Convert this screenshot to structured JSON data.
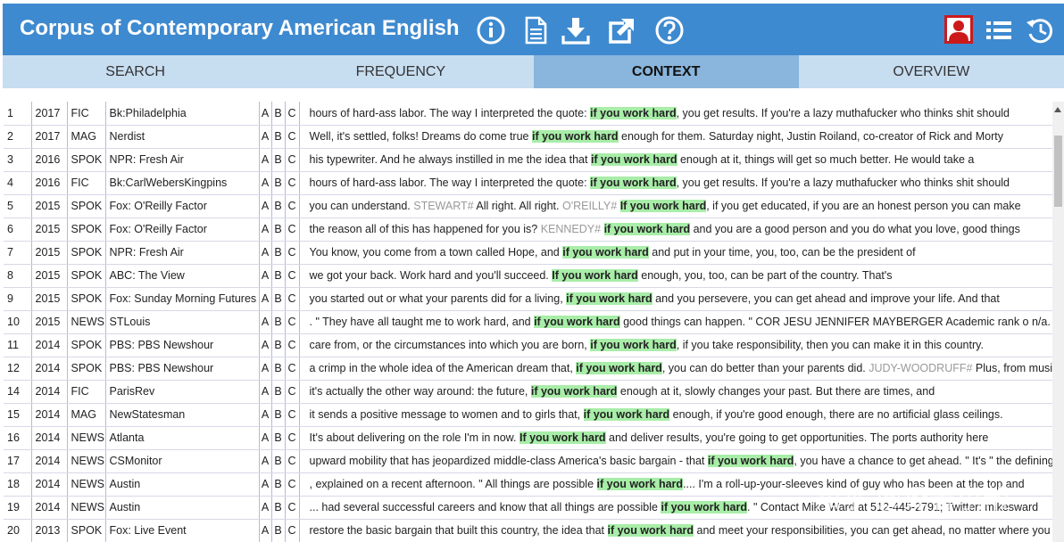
{
  "app": {
    "title": "Corpus of Contemporary American English",
    "icons": [
      "info-icon",
      "document-icon",
      "download-icon",
      "external-link-icon",
      "help-icon",
      "user-icon",
      "list-icon",
      "history-icon"
    ],
    "colors": {
      "header": "#3e8ad0",
      "tabs": "#c7ddf0",
      "active_tab": "#8ab5dc",
      "keyword_highlight": "#a8eda8",
      "user_icon_border": "#cc1a1a"
    }
  },
  "tabs": [
    {
      "label": "SEARCH",
      "active": false
    },
    {
      "label": "FREQUENCY",
      "active": false
    },
    {
      "label": "CONTEXT",
      "active": true
    },
    {
      "label": "OVERVIEW",
      "active": false
    }
  ],
  "results": [
    {
      "n": "1",
      "year": "2017",
      "genre": "FIC",
      "source": "Bk:Philadelphia",
      "a": "A",
      "b": "B",
      "c": "C",
      "segments": [
        {
          "t": "hours of hard-ass labor. The way I interpreted the quote: "
        },
        {
          "t": "if you work hard",
          "kw": true
        },
        {
          "t": ", you get results. If you're a lazy muthafucker who thinks shit should"
        }
      ]
    },
    {
      "n": "2",
      "year": "2017",
      "genre": "MAG",
      "source": "Nerdist",
      "a": "A",
      "b": "B",
      "c": "C",
      "segments": [
        {
          "t": "Well, it's settled, folks! Dreams do come true "
        },
        {
          "t": "if you work hard",
          "kw": true
        },
        {
          "t": " enough for them. Saturday night, Justin Roiland, co-creator of Rick and Morty"
        }
      ]
    },
    {
      "n": "3",
      "year": "2016",
      "genre": "SPOK",
      "source": "NPR: Fresh Air",
      "a": "A",
      "b": "B",
      "c": "C",
      "segments": [
        {
          "t": "his typewriter. And he always instilled in me the idea that "
        },
        {
          "t": "if you work hard",
          "kw": true
        },
        {
          "t": " enough at it, things will get so much better. He would take a"
        }
      ]
    },
    {
      "n": "4",
      "year": "2016",
      "genre": "FIC",
      "source": "Bk:CarlWebersKingpins",
      "a": "A",
      "b": "B",
      "c": "C",
      "segments": [
        {
          "t": "hours of hard-ass labor. The way I interpreted the quote: "
        },
        {
          "t": "if you work hard",
          "kw": true
        },
        {
          "t": ", you get results. If you're a lazy muthafucker who thinks shit should"
        }
      ]
    },
    {
      "n": "5",
      "year": "2015",
      "genre": "SPOK",
      "source": "Fox: O'Reilly Factor",
      "a": "A",
      "b": "B",
      "c": "C",
      "segments": [
        {
          "t": "you can understand. "
        },
        {
          "t": "STEWART#",
          "spk": true
        },
        {
          "t": " All right. All right. "
        },
        {
          "t": "O'REILLY#",
          "spk": true
        },
        {
          "t": " "
        },
        {
          "t": "If you work hard",
          "kw": true
        },
        {
          "t": ", if you get educated, if you are an honest person you can make"
        }
      ]
    },
    {
      "n": "6",
      "year": "2015",
      "genre": "SPOK",
      "source": "Fox: O'Reilly Factor",
      "a": "A",
      "b": "B",
      "c": "C",
      "segments": [
        {
          "t": "the reason all of this has happened for you is? "
        },
        {
          "t": "KENNEDY#",
          "spk": true
        },
        {
          "t": " "
        },
        {
          "t": "if you work hard",
          "kw": true
        },
        {
          "t": " and you are a good person and you do what you love, good things"
        }
      ]
    },
    {
      "n": "7",
      "year": "2015",
      "genre": "SPOK",
      "source": "NPR: Fresh Air",
      "a": "A",
      "b": "B",
      "c": "C",
      "segments": [
        {
          "t": "You know, you come from a town called Hope, and "
        },
        {
          "t": "if you work hard",
          "kw": true
        },
        {
          "t": " and put in your time, you, too, can be the president of"
        }
      ]
    },
    {
      "n": "8",
      "year": "2015",
      "genre": "SPOK",
      "source": "ABC: The View",
      "a": "A",
      "b": "B",
      "c": "C",
      "segments": [
        {
          "t": "we got your back. Work hard and you'll succeed. "
        },
        {
          "t": "If you work hard",
          "kw": true
        },
        {
          "t": " enough, you, too, can be part of the country. That's"
        }
      ]
    },
    {
      "n": "9",
      "year": "2015",
      "genre": "SPOK",
      "source": "Fox: Sunday Morning Futures",
      "a": "A",
      "b": "B",
      "c": "C",
      "segments": [
        {
          "t": "you started out or what your parents did for a living, "
        },
        {
          "t": "if you work hard",
          "kw": true
        },
        {
          "t": " and you persevere, you can get ahead and improve your life. And that"
        }
      ]
    },
    {
      "n": "10",
      "year": "2015",
      "genre": "NEWS",
      "source": "STLouis",
      "a": "A",
      "b": "B",
      "c": "C",
      "segments": [
        {
          "t": ". \" They have all taught me to work hard, and "
        },
        {
          "t": "if you work hard",
          "kw": true
        },
        {
          "t": " good things can happen. \" COR JESU JENNIFER MAYBERGER Academic rank o n/a."
        }
      ]
    },
    {
      "n": "11",
      "year": "2014",
      "genre": "SPOK",
      "source": "PBS: PBS Newshour",
      "a": "A",
      "b": "B",
      "c": "C",
      "segments": [
        {
          "t": "care from, or the circumstances into which you are born, "
        },
        {
          "t": "if you work hard",
          "kw": true
        },
        {
          "t": ", if you take responsibility, then you can make it in this country."
        }
      ]
    },
    {
      "n": "12",
      "year": "2014",
      "genre": "SPOK",
      "source": "PBS: PBS Newshour",
      "a": "A",
      "b": "B",
      "c": "C",
      "segments": [
        {
          "t": "a crimp in the whole idea of the American dream that, "
        },
        {
          "t": "if you work hard",
          "kw": true
        },
        {
          "t": ", you can do better than your parents did. "
        },
        {
          "t": "JUDY-WOODRUFF#",
          "spk": true
        },
        {
          "t": " Plus, from music"
        }
      ]
    },
    {
      "n": "14",
      "year": "2014",
      "genre": "FIC",
      "source": "ParisRev",
      "a": "A",
      "b": "B",
      "c": "C",
      "segments": [
        {
          "t": "it's actually the other way around: the future, "
        },
        {
          "t": "if you work hard",
          "kw": true
        },
        {
          "t": " enough at it, slowly changes your past. But there are times, and"
        }
      ]
    },
    {
      "n": "15",
      "year": "2014",
      "genre": "MAG",
      "source": "NewStatesman",
      "a": "A",
      "b": "B",
      "c": "C",
      "segments": [
        {
          "t": "it sends a positive message to women and to girls that, "
        },
        {
          "t": "if you work hard",
          "kw": true
        },
        {
          "t": " enough, if you're good enough, there are no artificial glass ceilings."
        }
      ]
    },
    {
      "n": "16",
      "year": "2014",
      "genre": "NEWS",
      "source": "Atlanta",
      "a": "A",
      "b": "B",
      "c": "C",
      "segments": [
        {
          "t": "It's about delivering on the role I'm in now. "
        },
        {
          "t": "If you work hard",
          "kw": true
        },
        {
          "t": " and deliver results, you're going to get opportunities. The ports authority here"
        }
      ]
    },
    {
      "n": "17",
      "year": "2014",
      "genre": "NEWS",
      "source": "CSMonitor",
      "a": "A",
      "b": "B",
      "c": "C",
      "segments": [
        {
          "t": "upward mobility that has jeopardized middle-class America's basic bargain - that "
        },
        {
          "t": "if you work hard",
          "kw": true
        },
        {
          "t": ", you have a chance to get ahead. \" It's \" the defining"
        }
      ]
    },
    {
      "n": "18",
      "year": "2014",
      "genre": "NEWS",
      "source": "Austin",
      "a": "A",
      "b": "B",
      "c": "C",
      "segments": [
        {
          "t": ", explained on a recent afternoon. \" All things are possible "
        },
        {
          "t": "if you work hard",
          "kw": true
        },
        {
          "t": ".... I'm a roll-up-your-sleeves kind of guy who has been at the top and"
        }
      ]
    },
    {
      "n": "19",
      "year": "2014",
      "genre": "NEWS",
      "source": "Austin",
      "a": "A",
      "b": "B",
      "c": "C",
      "segments": [
        {
          "t": "... had several successful careers and know that all things are possible "
        },
        {
          "t": "if you work hard",
          "kw": true
        },
        {
          "t": ". \" Contact Mike Ward at 512-445-2791; Twitter: mikesward"
        }
      ]
    },
    {
      "n": "20",
      "year": "2013",
      "genre": "SPOK",
      "source": "Fox: Live Event",
      "a": "A",
      "b": "B",
      "c": "C",
      "segments": [
        {
          "t": "restore the basic bargain that built this country, the idea that "
        },
        {
          "t": "if you work hard",
          "kw": true
        },
        {
          "t": " and meet your responsibilities, you can get ahead, no matter where you"
        }
      ]
    }
  ],
  "watermark": "知乎 @译者小帮"
}
